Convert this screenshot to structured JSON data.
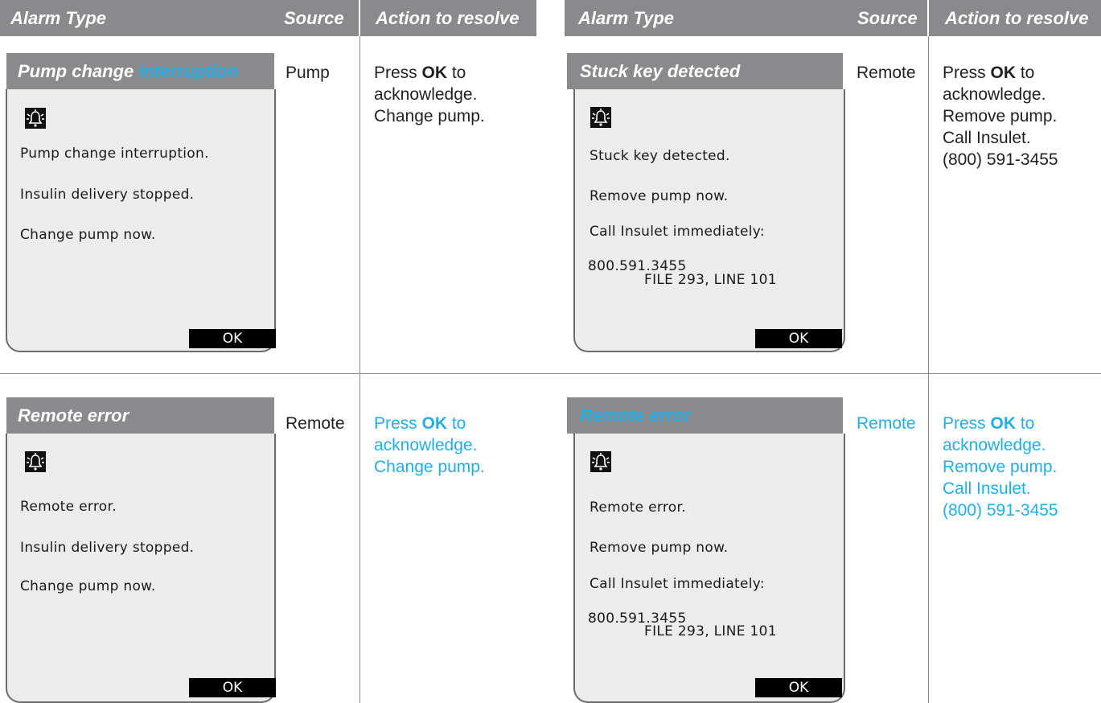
{
  "headers": {
    "left": {
      "alarm_type": "Alarm Type",
      "source": "Source",
      "action": "Action to resolve"
    },
    "right": {
      "alarm_type": "Alarm Type",
      "source": "Source",
      "action": "Action to resolve"
    }
  },
  "rows": [
    {
      "title_part1": "Pump change ",
      "title_part2": "interruption",
      "source": "Pump",
      "screen_lines": [
        "Pump change interruption.",
        "Insulin delivery stopped.",
        "Change pump now."
      ],
      "ok": "OK",
      "action": {
        "press": "Press ",
        "ok": "OK",
        "to": " to",
        "lines": [
          "acknowledge.",
          "Change pump."
        ]
      }
    },
    {
      "title": "Stuck key detected",
      "source": "Remote",
      "screen_lines": [
        "Stuck key detected.",
        "Remove pump now.",
        "Call Insulet immediately:",
        "800.591.3455",
        "FILE 293, LINE 101"
      ],
      "ok": "OK",
      "action": {
        "press": "Press ",
        "ok": "OK",
        "to": " to",
        "lines": [
          "acknowledge.",
          "Remove pump.",
          "Call Insulet.",
          "(800) 591-3455"
        ]
      }
    },
    {
      "title": "Remote error",
      "source": "Remote",
      "screen_lines": [
        "Remote error.",
        "Insulin delivery stopped.",
        "Change pump now."
      ],
      "ok": "OK",
      "action": {
        "press": "Press ",
        "ok": "OK",
        "to": " to",
        "lines": [
          "acknowledge.",
          "Change pump."
        ]
      }
    },
    {
      "title": "Remote error",
      "source": "Remote",
      "screen_lines": [
        "Remote error.",
        "Remove pump now.",
        "Call Insulet immediately:",
        "800.591.3455",
        "FILE 293, LINE 101"
      ],
      "ok": "OK",
      "action": {
        "press": "Press ",
        "ok": "OK",
        "to": " to",
        "lines": [
          "acknowledge.",
          "Remove pump.",
          "Call Insulet.",
          "(800) 591-3455"
        ]
      }
    }
  ],
  "colors": {
    "header_gray": "#8a8a8c",
    "highlight_blue": "#22aee6"
  },
  "icons": {
    "alarm": "alarm-bell-icon"
  }
}
